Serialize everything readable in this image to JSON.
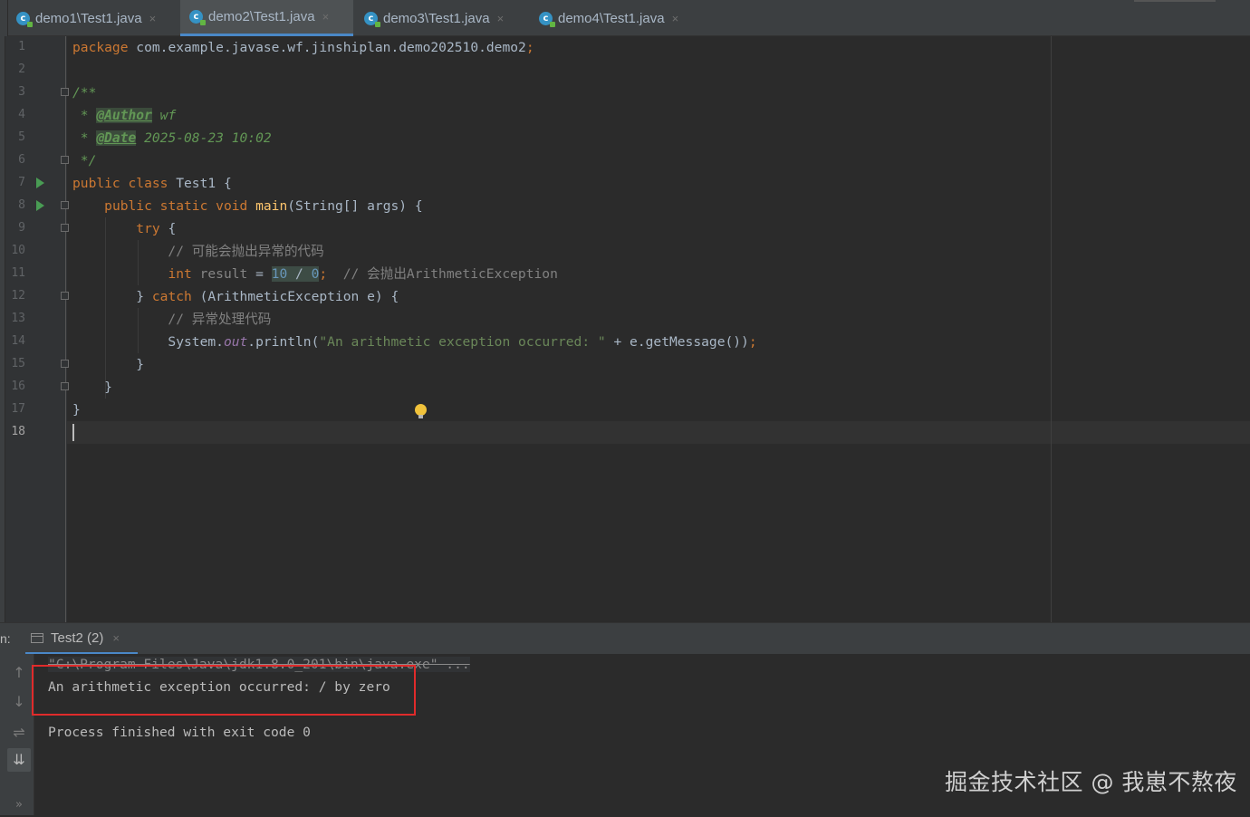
{
  "tabs": [
    {
      "label": "demo1\\Test1.java",
      "close": "×",
      "active": false
    },
    {
      "label": "demo2\\Test1.java",
      "close": "×",
      "active": true
    },
    {
      "label": "demo3\\Test1.java",
      "close": "×",
      "active": false
    },
    {
      "label": "demo4\\Test1.java",
      "close": "×",
      "active": false
    }
  ],
  "file_icon_letter": "c",
  "line_numbers": [
    "1",
    "2",
    "3",
    "4",
    "5",
    "6",
    "7",
    "8",
    "9",
    "10",
    "11",
    "12",
    "13",
    "14",
    "15",
    "16",
    "17",
    "18"
  ],
  "current_line": 18,
  "code": {
    "l1_kw": "package",
    "l1_rest": " com.example.javase.wf.jinshiplan.demo202510.demo2",
    "l1_semi": ";",
    "l3": "/**",
    "l4_star": " * ",
    "l4_tag": "@Author",
    "l4_val": " wf",
    "l5_star": " * ",
    "l5_tag": "@Date",
    "l5_val": " 2025-08-23 10:02",
    "l6": " */",
    "l7_kw": "public class",
    "l7_rest": " Test1 {",
    "l8_indent": "    ",
    "l8_kw": "public static void",
    "l8_sp": " ",
    "l8_fn": "main",
    "l8_rest": "(String[] args) {",
    "l9_indent": "        ",
    "l9_kw": "try",
    "l9_rest": " {",
    "l10": "            // 可能会抛出异常的代码",
    "l11_indent": "            ",
    "l11_kw": "int",
    "l11_var": " result",
    "l11_eq": " = ",
    "l11_n1": "10",
    "l11_div": " / ",
    "l11_n2": "0",
    "l11_semi": ";",
    "l11_comment": "  // 会抛出ArithmeticException",
    "l12_a": "        } ",
    "l12_kw": "catch",
    "l12_b": " (ArithmeticException e) {",
    "l13": "            // 异常处理代码",
    "l14_a": "            System.",
    "l14_out": "out",
    "l14_b": ".println(",
    "l14_str": "\"An arithmetic exception occurred: \"",
    "l14_c": " + e.getMessage())",
    "l14_semi": ";",
    "l15": "        }",
    "l16": "    }",
    "l17": "}"
  },
  "run_panel": {
    "label": "n:",
    "tab_label": "Test2 (2)",
    "tab_close": "×",
    "console_lines": [
      "\"C:\\Program Files\\Java\\jdk1.8.0_201\\bin\\java.exe\" ...",
      "An arithmetic exception occurred: / by zero",
      "Process finished with exit code 0"
    ],
    "tools": {
      "up": "↑",
      "down": "↓",
      "wrap": "⇌",
      "scroll": "⇊",
      "more": "»"
    }
  },
  "watermark": "掘金技术社区 @ 我崽不熬夜",
  "colors": {
    "background": "#2b2b2b",
    "keyword": "#cc7832",
    "string": "#6a8759",
    "number": "#6897bb",
    "comment": "#808080",
    "highlight_box": "#e02b2b"
  }
}
